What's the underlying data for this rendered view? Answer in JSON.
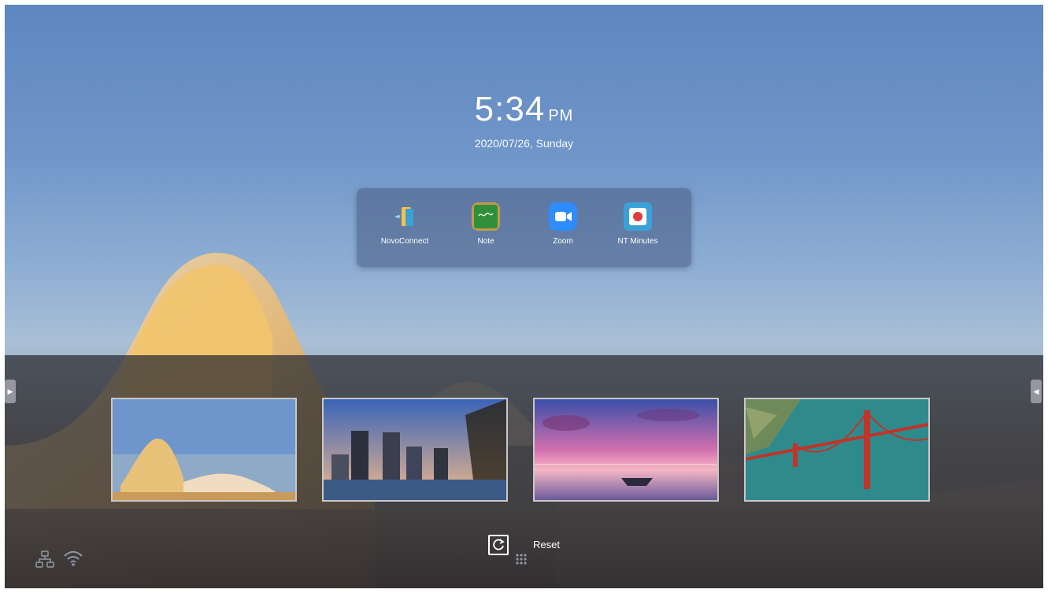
{
  "clock": {
    "time": "5:34",
    "ampm": "PM",
    "date": "2020/07/26, Sunday"
  },
  "apps": [
    {
      "label": "NovoConnect",
      "icon": "novoconnect-icon",
      "color": "#3aa0d8"
    },
    {
      "label": "Note",
      "icon": "chalkboard-icon",
      "color": "#2f8f3a"
    },
    {
      "label": "Zoom",
      "icon": "video-camera-icon",
      "color": "#2d8cff"
    },
    {
      "label": "NT Minutes",
      "icon": "record-icon",
      "color": "#3aa0d8"
    }
  ],
  "wallpapers": [
    {
      "name": "curved-building",
      "icon": "wallpaper-thumbnail"
    },
    {
      "name": "city-skyline",
      "icon": "wallpaper-thumbnail"
    },
    {
      "name": "sunset-boat",
      "icon": "wallpaper-thumbnail"
    },
    {
      "name": "golden-gate-bridge",
      "icon": "wallpaper-thumbnail"
    }
  ],
  "reset": {
    "label": "Reset",
    "icon": "refresh-icon"
  },
  "status": {
    "network_icon": "network-icon",
    "wifi_icon": "wifi-icon",
    "apps_grid_icon": "grid-icon"
  },
  "navigation": {
    "left_icon": "chevron-right-icon",
    "right_icon": "chevron-left-icon"
  }
}
